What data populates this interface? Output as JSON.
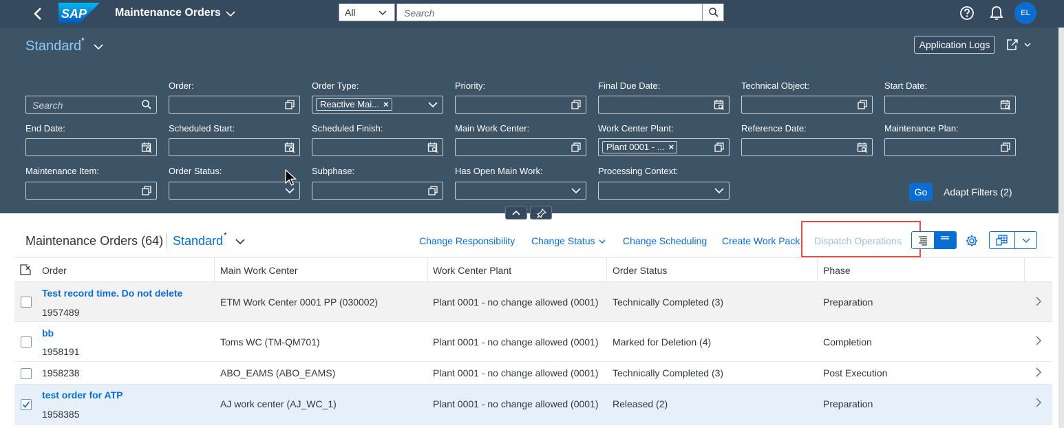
{
  "shell": {
    "title": "Maintenance Orders",
    "logo_text": "SAP",
    "scope": "All",
    "search_placeholder": "Search",
    "avatar_initials": "EL"
  },
  "filterbar": {
    "variant": "Standard",
    "variant_modified": "*",
    "app_logs": "Application Logs",
    "basic_search_placeholder": "Search",
    "go": "Go",
    "adapt_filters": "Adapt Filters (2)",
    "fields": {
      "order": "Order:",
      "order_type": "Order Type:",
      "priority": "Priority:",
      "final_due_date": "Final Due Date:",
      "technical_object": "Technical Object:",
      "start_date": "Start Date:",
      "end_date": "End Date:",
      "scheduled_start": "Scheduled Start:",
      "scheduled_finish": "Scheduled Finish:",
      "main_work_center": "Main Work Center:",
      "work_center_plant": "Work Center Plant:",
      "reference_date": "Reference Date:",
      "maintenance_plan": "Maintenance Plan:",
      "maintenance_item": "Maintenance Item:",
      "order_status": "Order Status:",
      "subphase": "Subphase:",
      "has_open_main_work": "Has Open Main Work:",
      "processing_context": "Processing Context:"
    },
    "tokens": {
      "order_type": "Reactive Mai...",
      "work_center_plant": "Plant 0001 - ..."
    }
  },
  "table": {
    "title": "Maintenance Orders (64)",
    "variant": "Standard",
    "variant_modified": "*",
    "actions": {
      "change_responsibility": "Change Responsibility",
      "change_status": "Change Status",
      "change_scheduling": "Change Scheduling",
      "create_work_pack": "Create Work Pack",
      "dispatch_operations": "Dispatch Operations"
    },
    "columns": [
      "Order",
      "Main Work Center",
      "Work Center Plant",
      "Order Status",
      "Phase"
    ],
    "rows": [
      {
        "description": "Test record time. Do not delete",
        "order": "1957489",
        "work_center": "ETM Work Center 0001 PP (030002)",
        "plant": "Plant 0001 - no change allowed (0001)",
        "status": "Technically Completed (3)",
        "phase": "Preparation",
        "selected": false
      },
      {
        "description": "bb",
        "order": "1958191",
        "work_center": "Toms WC (TM-QM701)",
        "plant": "Plant 0001 - no change allowed (0001)",
        "status": "Marked for Deletion (4)",
        "phase": "Completion",
        "selected": false
      },
      {
        "description": "",
        "order": "1958238",
        "work_center": "ABO_EAMS (ABO_EAMS)",
        "plant": "Plant 0001 - no change allowed (0001)",
        "status": "Technically Completed (3)",
        "phase": "Post Execution",
        "selected": false
      },
      {
        "description": "test order for ATP",
        "order": "1958385",
        "work_center": "AJ work center (AJ_WC_1)",
        "plant": "Plant 0001 - no change allowed (0001)",
        "status": "Released (2)",
        "phase": "Preparation",
        "selected": true
      }
    ]
  },
  "colors": {
    "shell_bg": "#354a5f",
    "filter_bg": "#3d5366",
    "accent": "#0a6ed1",
    "highlight_box": "#e84a4a",
    "selected_row": "#e5f0fa",
    "hover_row": "#f2f2f2"
  }
}
